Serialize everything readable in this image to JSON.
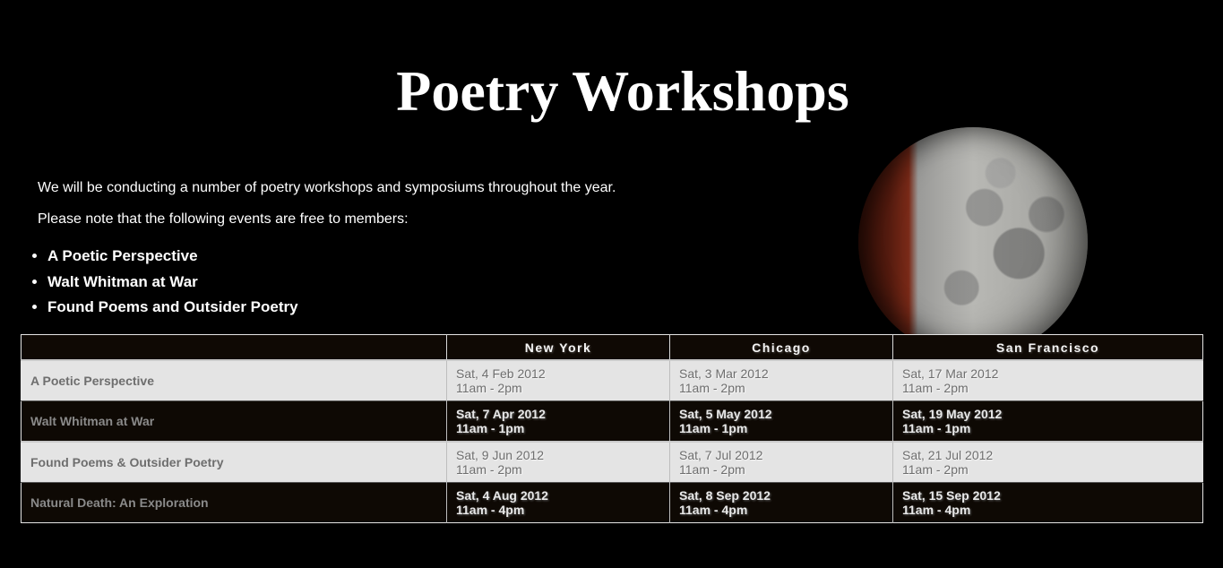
{
  "header": {
    "title": "Poetry Workshops"
  },
  "intro": {
    "paragraph1": "We will be conducting a number of poetry workshops and symposiums throughout the year.",
    "paragraph2": "Please note that the following events are free to members:"
  },
  "free_events": [
    "A Poetic Perspective",
    "Walt Whitman at War",
    "Found Poems and Outsider Poetry"
  ],
  "schedule": {
    "columns": [
      "",
      "New York",
      "Chicago",
      "San Francisco"
    ],
    "rows": [
      {
        "event": "A Poetic Perspective",
        "new_york": {
          "date": "Sat, 4 Feb 2012",
          "time": "11am - 2pm"
        },
        "chicago": {
          "date": "Sat, 3 Mar 2012",
          "time": "11am - 2pm"
        },
        "san_francisco": {
          "date": "Sat, 17 Mar 2012",
          "time": "11am - 2pm"
        }
      },
      {
        "event": "Walt Whitman at War",
        "new_york": {
          "date": "Sat, 7 Apr 2012",
          "time": "11am - 1pm"
        },
        "chicago": {
          "date": "Sat, 5 May 2012",
          "time": "11am - 1pm"
        },
        "san_francisco": {
          "date": "Sat, 19 May 2012",
          "time": "11am - 1pm"
        }
      },
      {
        "event": "Found Poems & Outsider Poetry",
        "new_york": {
          "date": "Sat, 9 Jun 2012",
          "time": "11am - 2pm"
        },
        "chicago": {
          "date": "Sat, 7 Jul 2012",
          "time": "11am - 2pm"
        },
        "san_francisco": {
          "date": "Sat, 21 Jul 2012",
          "time": "11am - 2pm"
        }
      },
      {
        "event": "Natural Death: An Exploration",
        "new_york": {
          "date": "Sat, 4 Aug 2012",
          "time": "11am - 4pm"
        },
        "chicago": {
          "date": "Sat, 8 Sep 2012",
          "time": "11am - 4pm"
        },
        "san_francisco": {
          "date": "Sat, 15 Sep 2012",
          "time": "11am - 4pm"
        }
      }
    ]
  },
  "colors": {
    "background": "#000000",
    "header_cell": "#0f0904",
    "light_row": "#e4e4e4",
    "dark_row": "#0e0904"
  },
  "image": {
    "name": "moon-image"
  }
}
